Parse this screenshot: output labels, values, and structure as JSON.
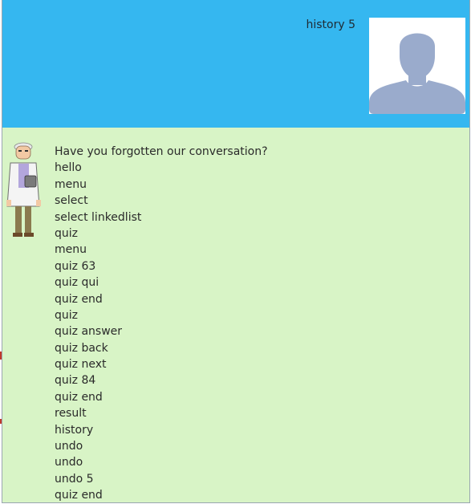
{
  "conversation": {
    "user_message": "history 5",
    "user_avatar_icon": "default-user-silhouette-icon",
    "bot_avatar_icon": "professor-sprite-icon",
    "bot_lines": [
      "Have you forgotten our conversation?",
      "hello",
      "menu",
      "select",
      "select linkedlist",
      "quiz",
      "menu",
      "quiz 63",
      "quiz qui",
      "quiz end",
      "quiz",
      "quiz answer",
      "quiz back",
      "quiz next",
      "quiz 84",
      "quiz end",
      "result",
      "history",
      "undo",
      "undo",
      "undo 5",
      "quiz end"
    ]
  },
  "colors": {
    "user_panel": "#35b7f0",
    "bot_panel": "#d8f4c6",
    "avatar_silhouette": "#9aabcc"
  }
}
